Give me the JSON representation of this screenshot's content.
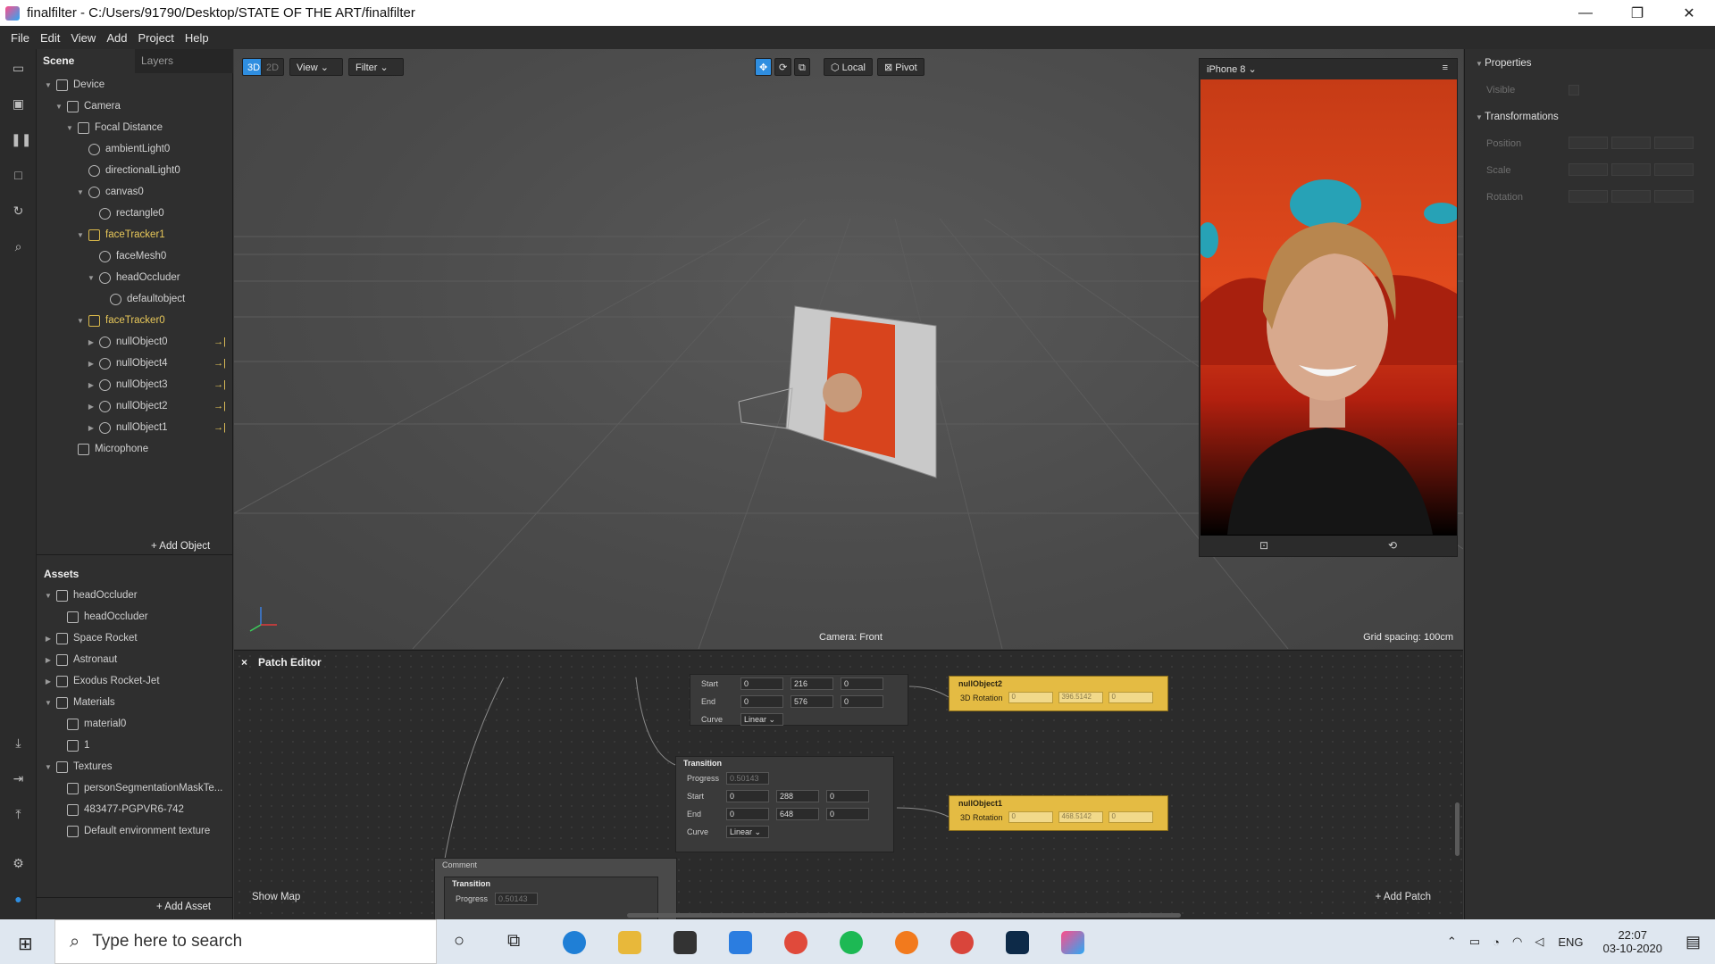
{
  "window": {
    "title": "finalfilter - C:/Users/91790/Desktop/STATE OF THE ART/finalfilter",
    "minimize": "—",
    "restore": "❐",
    "close": "✕"
  },
  "menu": [
    "File",
    "Edit",
    "View",
    "Add",
    "Project",
    "Help"
  ],
  "scene_tabs": {
    "scene": "Scene",
    "layers": "Layers"
  },
  "scene_tree": [
    {
      "label": "Device",
      "level": 0,
      "arrow": "▼",
      "yellow": false
    },
    {
      "label": "Camera",
      "level": 1,
      "arrow": "▼",
      "yellow": false
    },
    {
      "label": "Focal Distance",
      "level": 2,
      "arrow": "▼",
      "yellow": false
    },
    {
      "label": "ambientLight0",
      "level": 3,
      "arrow": "",
      "yellow": false
    },
    {
      "label": "directionalLight0",
      "level": 3,
      "arrow": "",
      "yellow": false
    },
    {
      "label": "canvas0",
      "level": 3,
      "arrow": "▼",
      "yellow": false
    },
    {
      "label": "rectangle0",
      "level": 4,
      "arrow": "",
      "yellow": false
    },
    {
      "label": "faceTracker1",
      "level": 3,
      "arrow": "▼",
      "yellow": true
    },
    {
      "label": "faceMesh0",
      "level": 4,
      "arrow": "",
      "yellow": false
    },
    {
      "label": "headOccluder",
      "level": 4,
      "arrow": "▼",
      "yellow": false
    },
    {
      "label": "defaultobject",
      "level": 5,
      "arrow": "",
      "yellow": false
    },
    {
      "label": "faceTracker0",
      "level": 3,
      "arrow": "▼",
      "yellow": true
    },
    {
      "label": "nullObject0",
      "level": 4,
      "arrow": "▶",
      "yellow": false,
      "link": true
    },
    {
      "label": "nullObject4",
      "level": 4,
      "arrow": "▶",
      "yellow": false,
      "link": true
    },
    {
      "label": "nullObject3",
      "level": 4,
      "arrow": "▶",
      "yellow": false,
      "link": true
    },
    {
      "label": "nullObject2",
      "level": 4,
      "arrow": "▶",
      "yellow": false,
      "link": true
    },
    {
      "label": "nullObject1",
      "level": 4,
      "arrow": "▶",
      "yellow": false,
      "link": true
    },
    {
      "label": "Microphone",
      "level": 2,
      "arrow": "",
      "yellow": false
    }
  ],
  "add_object": "+ Add Object",
  "assets_title": "Assets",
  "assets": [
    {
      "label": "headOccluder",
      "level": 0,
      "arrow": "▼"
    },
    {
      "label": "headOccluder",
      "level": 1,
      "arrow": ""
    },
    {
      "label": "Space Rocket",
      "level": 0,
      "arrow": "▶"
    },
    {
      "label": "Astronaut",
      "level": 0,
      "arrow": "▶"
    },
    {
      "label": "Exodus Rocket-Jet",
      "level": 0,
      "arrow": "▶"
    },
    {
      "label": "Materials",
      "level": 0,
      "arrow": "▼"
    },
    {
      "label": "material0",
      "level": 1,
      "arrow": ""
    },
    {
      "label": "1",
      "level": 1,
      "arrow": ""
    },
    {
      "label": "Textures",
      "level": 0,
      "arrow": "▼"
    },
    {
      "label": "personSegmentationMaskTe...",
      "level": 1,
      "arrow": ""
    },
    {
      "label": "483477-PGPVR6-742",
      "level": 1,
      "arrow": ""
    },
    {
      "label": "Default environment texture",
      "level": 1,
      "arrow": ""
    }
  ],
  "add_asset": "+ Add Asset",
  "viewport": {
    "btn_3d": "3D",
    "btn_2d": "2D",
    "view": "View ⌄",
    "filter": "Filter ⌄",
    "local": "Local",
    "pivot": "Pivot",
    "camera_label": "Camera: Front",
    "grid_label": "Grid spacing: 100cm"
  },
  "simulator": {
    "device": "iPhone 8 ⌄",
    "menu_icon": "≡"
  },
  "properties": {
    "title": "Properties",
    "visible": "Visible",
    "transformations": "Transformations",
    "position": "Position",
    "scale": "Scale",
    "rotation": "Rotation"
  },
  "patch_editor": {
    "title": "Patch Editor",
    "close": "×",
    "show_map": "Show Map",
    "add_patch": "+ Add Patch",
    "comment": "Comment",
    "node_top": {
      "start": [
        "0",
        "216",
        "0"
      ],
      "end": [
        "0",
        "576",
        "0"
      ],
      "curve": "Linear ⌄"
    },
    "node_mid": {
      "title": "Transition",
      "progress": "0.50143",
      "start": [
        "0",
        "288",
        "0"
      ],
      "end": [
        "0",
        "648",
        "0"
      ],
      "curve": "Linear ⌄"
    },
    "node_bottom": {
      "title": "Transition",
      "progress": "0.50143"
    },
    "null2": {
      "title": "nullObject2",
      "label": "3D Rotation",
      "vals": [
        "0",
        "396.5142",
        "0"
      ]
    },
    "null1": {
      "title": "nullObject1",
      "label": "3D Rotation",
      "vals": [
        "0",
        "468.5142",
        "0"
      ]
    },
    "labels": {
      "start": "Start",
      "end": "End",
      "curve": "Curve",
      "progress": "Progress"
    }
  },
  "taskbar": {
    "search_placeholder": "Type here to search",
    "lang": "ENG",
    "time": "22:07",
    "date": "03-10-2020"
  }
}
